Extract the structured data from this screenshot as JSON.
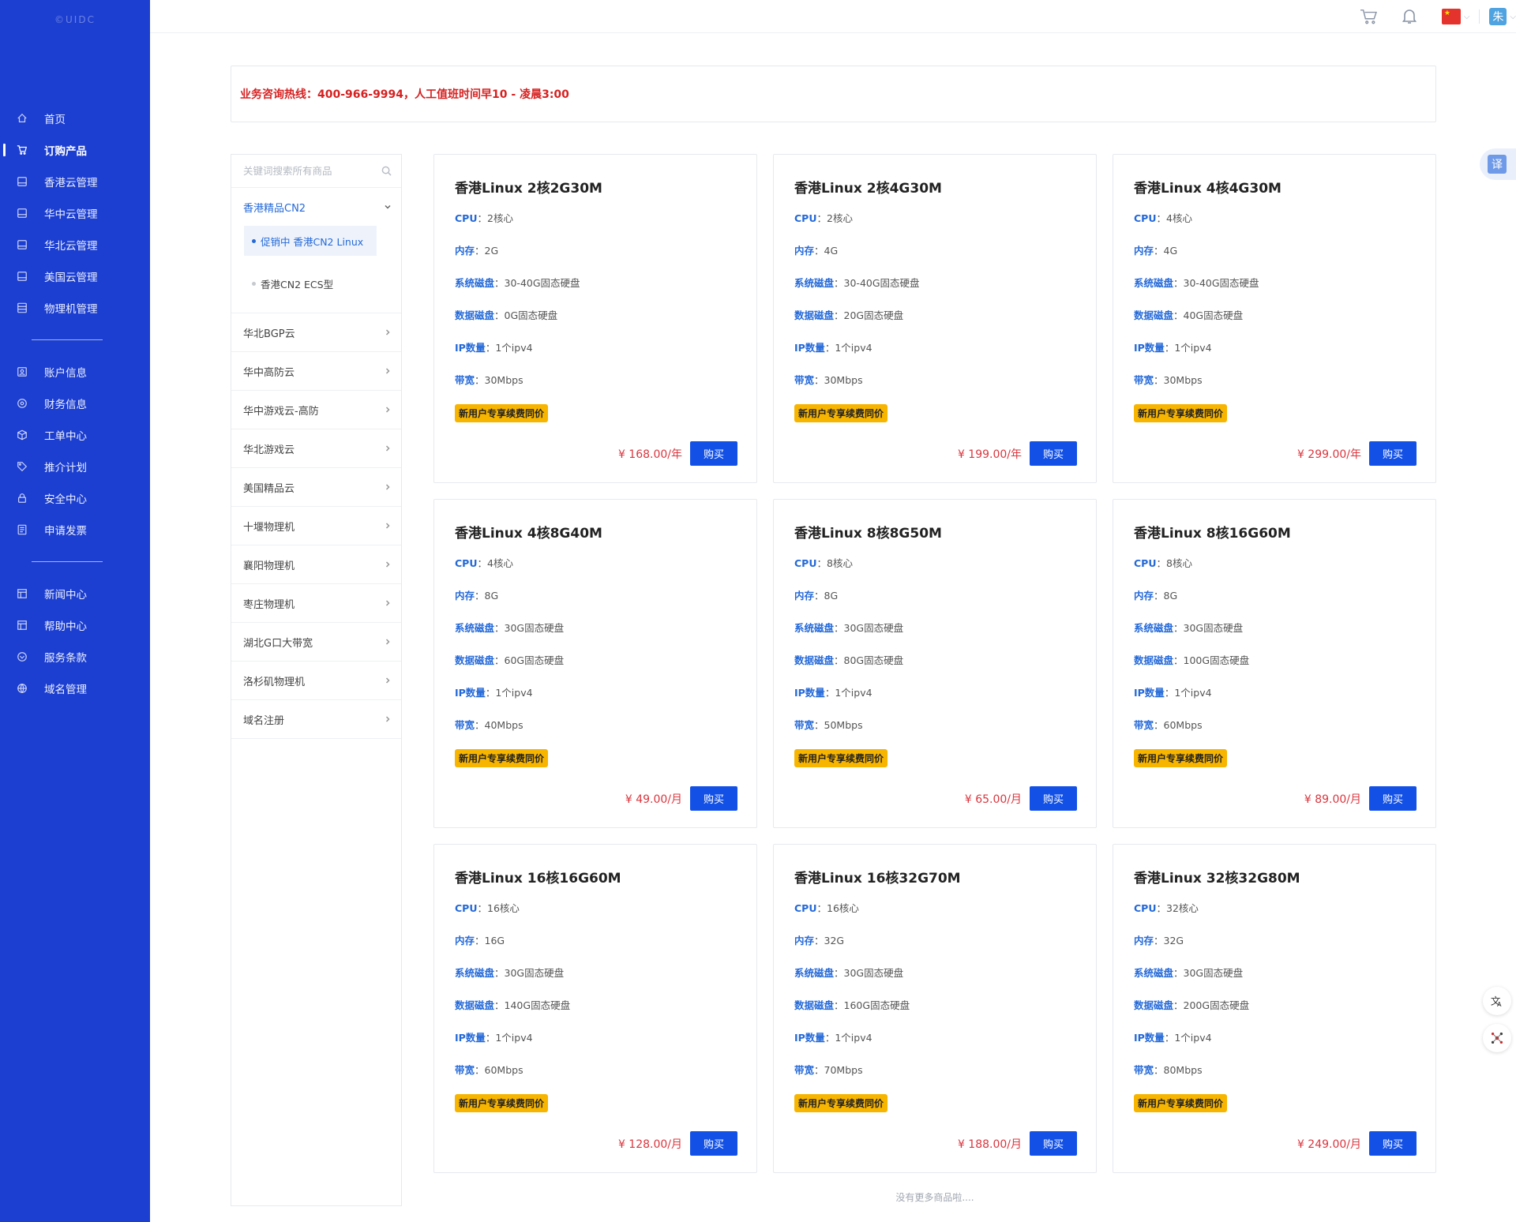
{
  "app": {
    "logo_text": "©UIDC"
  },
  "sidebar": {
    "items_top": [
      {
        "label": "首页",
        "icon": "home-icon"
      },
      {
        "label": "订购产品",
        "icon": "cart-icon",
        "active": true
      },
      {
        "label": "香港云管理",
        "icon": "server-icon"
      },
      {
        "label": "华中云管理",
        "icon": "server-icon"
      },
      {
        "label": "华北云管理",
        "icon": "server-icon"
      },
      {
        "label": "美国云管理",
        "icon": "server-icon"
      },
      {
        "label": "物理机管理",
        "icon": "rack-icon"
      }
    ],
    "items_middle": [
      {
        "label": "账户信息",
        "icon": "user-icon"
      },
      {
        "label": "财务信息",
        "icon": "finance-icon"
      },
      {
        "label": "工单中心",
        "icon": "box-icon"
      },
      {
        "label": "推介计划",
        "icon": "tag-icon"
      },
      {
        "label": "安全中心",
        "icon": "lock-icon"
      },
      {
        "label": "申请发票",
        "icon": "invoice-icon"
      }
    ],
    "items_bottom": [
      {
        "label": "新闻中心",
        "icon": "news-icon"
      },
      {
        "label": "帮助中心",
        "icon": "help-icon"
      },
      {
        "label": "服务条款",
        "icon": "terms-icon"
      },
      {
        "label": "域名管理",
        "icon": "globe-icon"
      }
    ]
  },
  "header": {
    "avatar_letter": "朱",
    "icons": [
      "cart-icon",
      "bell-icon",
      "china-flag-icon",
      "avatar"
    ]
  },
  "notice": {
    "text": "业务咨询热线：400-966-9994，人工值班时间早10 - 凌晨3:00"
  },
  "categories": {
    "search_placeholder": "关键词搜索所有商品",
    "open_group": {
      "label": "香港精品CN2",
      "subitems": [
        {
          "label": "促销中 香港CN2 Linux",
          "active": true
        },
        {
          "label": "香港CN2 ECS型",
          "active": false
        }
      ]
    },
    "groups": [
      "华北BGP云",
      "华中高防云",
      "华中游戏云-高防",
      "华北游戏云",
      "美国精品云",
      "十堰物理机",
      "襄阳物理机",
      "枣庄物理机",
      "湖北G口大带宽",
      "洛杉矶物理机",
      "域名注册"
    ]
  },
  "labels": {
    "cpu": "CPU",
    "mem": "内存",
    "sys_disk": "系统磁盘",
    "data_disk": "数据磁盘",
    "ip": "IP数量",
    "bw": "带宽",
    "sep": "：",
    "buy": "购买"
  },
  "products": [
    {
      "title": "香港Linux 2核2G30M",
      "cpu": "2核心",
      "mem": "2G",
      "sys_disk": "30-40G固态硬盘",
      "data_disk": "0G固态硬盘",
      "ip": "1个ipv4",
      "bw": "30Mbps",
      "badge": "新用户专享续费同价",
      "price": "¥ 168.00/年"
    },
    {
      "title": "香港Linux 2核4G30M",
      "cpu": "2核心",
      "mem": "4G",
      "sys_disk": "30-40G固态硬盘",
      "data_disk": "20G固态硬盘",
      "ip": "1个ipv4",
      "bw": "30Mbps",
      "badge": "新用户专享续费同价",
      "price": "¥ 199.00/年"
    },
    {
      "title": "香港Linux 4核4G30M",
      "cpu": "4核心",
      "mem": "4G",
      "sys_disk": "30-40G固态硬盘",
      "data_disk": "40G固态硬盘",
      "ip": "1个ipv4",
      "bw": "30Mbps",
      "badge": "新用户专享续费同价",
      "price": "¥ 299.00/年"
    },
    {
      "title": "香港Linux 4核8G40M",
      "cpu": "4核心",
      "mem": "8G",
      "sys_disk": "30G固态硬盘",
      "data_disk": "60G固态硬盘",
      "ip": "1个ipv4",
      "bw": "40Mbps",
      "badge": "新用户专享续费同价",
      "price": "¥ 49.00/月"
    },
    {
      "title": "香港Linux 8核8G50M",
      "cpu": "8核心",
      "mem": "8G",
      "sys_disk": "30G固态硬盘",
      "data_disk": "80G固态硬盘",
      "ip": "1个ipv4",
      "bw": "50Mbps",
      "badge": "新用户专享续费同价",
      "price": "¥ 65.00/月"
    },
    {
      "title": "香港Linux 8核16G60M",
      "cpu": "8核心",
      "mem": "8G",
      "sys_disk": "30G固态硬盘",
      "data_disk": "100G固态硬盘",
      "ip": "1个ipv4",
      "bw": "60Mbps",
      "badge": "新用户专享续费同价",
      "price": "¥ 89.00/月"
    },
    {
      "title": "香港Linux 16核16G60M",
      "cpu": "16核心",
      "mem": "16G",
      "sys_disk": "30G固态硬盘",
      "data_disk": "140G固态硬盘",
      "ip": "1个ipv4",
      "bw": "60Mbps",
      "badge": "新用户专享续费同价",
      "price": "¥ 128.00/月"
    },
    {
      "title": "香港Linux 16核32G70M",
      "cpu": "16核心",
      "mem": "32G",
      "sys_disk": "30G固态硬盘",
      "data_disk": "160G固态硬盘",
      "ip": "1个ipv4",
      "bw": "70Mbps",
      "badge": "新用户专享续费同价",
      "price": "¥ 188.00/月"
    },
    {
      "title": "香港Linux 32核32G80M",
      "cpu": "32核心",
      "mem": "32G",
      "sys_disk": "30G固态硬盘",
      "data_disk": "200G固态硬盘",
      "ip": "1个ipv4",
      "bw": "80Mbps",
      "badge": "新用户专享续费同价",
      "price": "¥ 249.00/月"
    }
  ],
  "footer": {
    "no_more": "没有更多商品啦...."
  },
  "floating": {
    "translate_glyph": "译",
    "icons": [
      "translate-icon",
      "language-tool-icon",
      "network-tool-icon"
    ]
  },
  "colors": {
    "sidebar": "#1c3fd1",
    "accent": "#2469d8",
    "buy_button": "#1351e6",
    "badge": "#f7b500",
    "price": "#d9363e",
    "notice": "#d62121"
  }
}
